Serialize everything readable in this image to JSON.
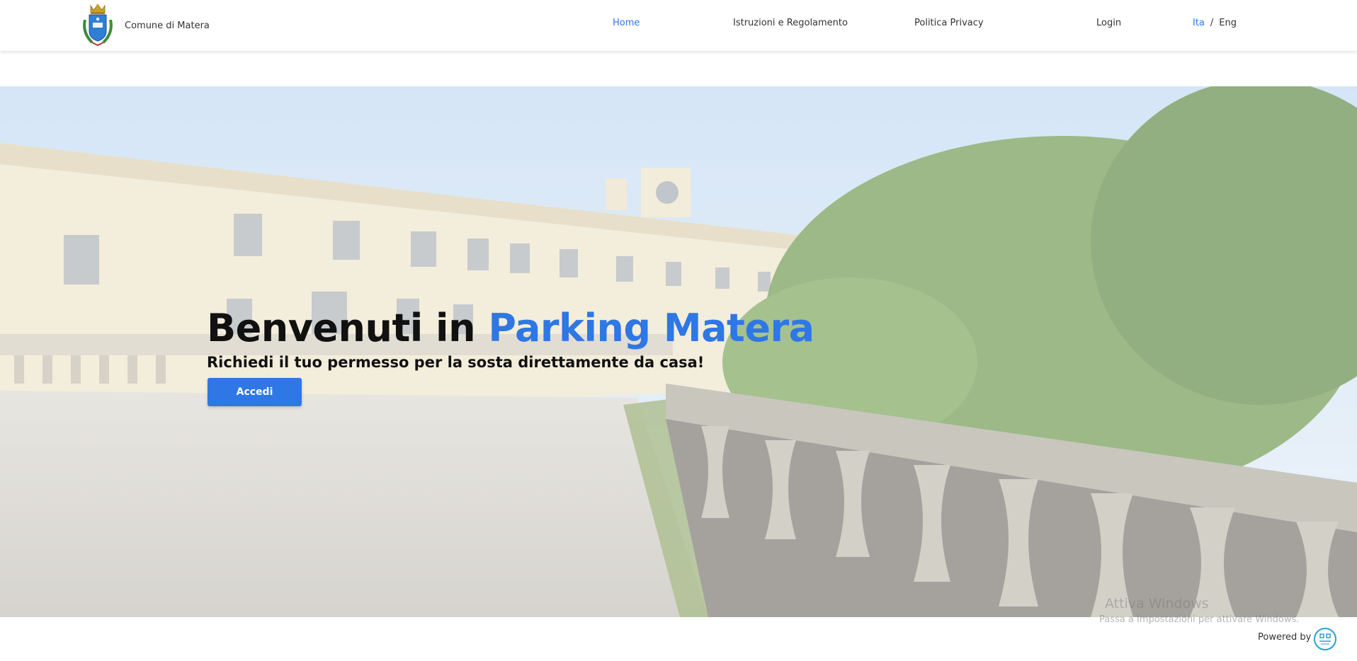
{
  "header": {
    "brand_name": "Comune di Matera",
    "crest_icon": "municipal-crest-icon"
  },
  "nav": {
    "items": [
      {
        "label": "Home",
        "active": true
      },
      {
        "label": "Istruzioni e Regolamento",
        "active": false
      },
      {
        "label": "Politica Privacy",
        "active": false
      },
      {
        "label": "Login",
        "active": false
      }
    ]
  },
  "language": {
    "ita": "Ita",
    "separator": "/",
    "eng": "Eng",
    "selected": "Ita"
  },
  "hero": {
    "title_prefix": "Benvenuti in ",
    "title_accent": "Parking Matera",
    "subtitle": "Richiedi il tuo permesso per la sosta direttamente da casa!",
    "button_label": "Accedi"
  },
  "watermark": {
    "title": "Attiva Windows",
    "subtitle": "Passa a Impostazioni per attivare Windows."
  },
  "footer": {
    "powered_by": "Powered by",
    "powered_logo_icon": "provider-logo-icon"
  },
  "colors": {
    "accent": "#2e77e5",
    "text": "#111111",
    "header_bg": "#ffffff"
  }
}
